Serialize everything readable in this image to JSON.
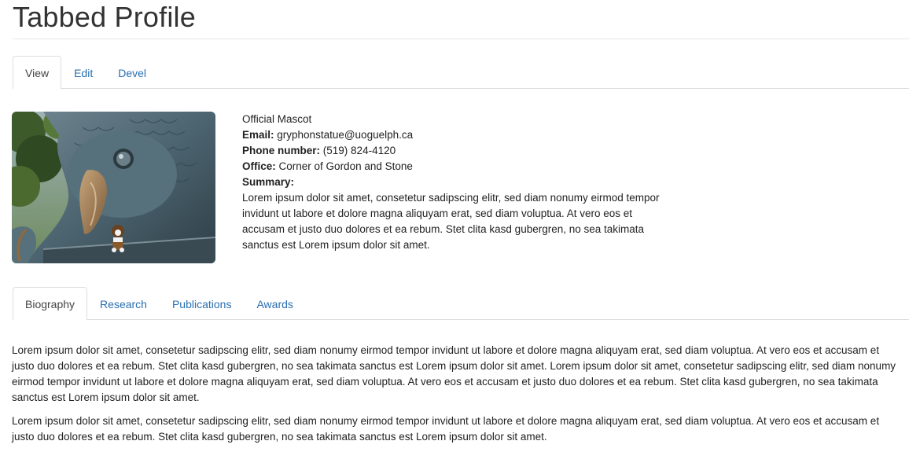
{
  "page": {
    "title": "Tabbed Profile"
  },
  "top_tabs": [
    {
      "label": "View",
      "active": true
    },
    {
      "label": "Edit",
      "active": false
    },
    {
      "label": "Devel",
      "active": false
    }
  ],
  "profile": {
    "role": "Official Mascot",
    "email_label": "Email:",
    "email": "gryphonstatue@uoguelph.ca",
    "phone_label": "Phone number:",
    "phone": "(519) 824-4120",
    "office_label": "Office:",
    "office": "Corner of Gordon and Stone",
    "summary_label": "Summary:",
    "summary": "Lorem ipsum dolor sit amet, consetetur sadipscing elitr, sed diam nonumy eirmod tempor invidunt ut labore et dolore magna aliquyam erat, sed diam voluptua. At vero eos et accusam et justo duo dolores et ea rebum. Stet clita kasd gubergren, no sea takimata sanctus est Lorem ipsum dolor sit amet."
  },
  "section_tabs": [
    {
      "label": "Biography",
      "active": true
    },
    {
      "label": "Research",
      "active": false
    },
    {
      "label": "Publications",
      "active": false
    },
    {
      "label": "Awards",
      "active": false
    }
  ],
  "biography": {
    "paragraphs": [
      "Lorem ipsum dolor sit amet, consetetur sadipscing elitr, sed diam nonumy eirmod tempor invidunt ut labore et dolore magna aliquyam erat, sed diam voluptua. At vero eos et accusam et justo duo dolores et ea rebum. Stet clita kasd gubergren, no sea takimata sanctus est Lorem ipsum dolor sit amet. Lorem ipsum dolor sit amet, consetetur sadipscing elitr, sed diam nonumy eirmod tempor invidunt ut labore et dolore magna aliquyam erat, sed diam voluptua. At vero eos et accusam et justo duo dolores et ea rebum. Stet clita kasd gubergren, no sea takimata sanctus est Lorem ipsum dolor sit amet.",
      "Lorem ipsum dolor sit amet, consetetur sadipscing elitr, sed diam nonumy eirmod tempor invidunt ut labore et dolore magna aliquyam erat, sed diam voluptua. At vero eos et accusam et justo duo dolores et ea rebum. Stet clita kasd gubergren, no sea takimata sanctus est Lorem ipsum dolor sit amet."
    ]
  },
  "colors": {
    "link": "#2a6fb0",
    "text": "#222222",
    "tab_border": "#dddddd"
  }
}
